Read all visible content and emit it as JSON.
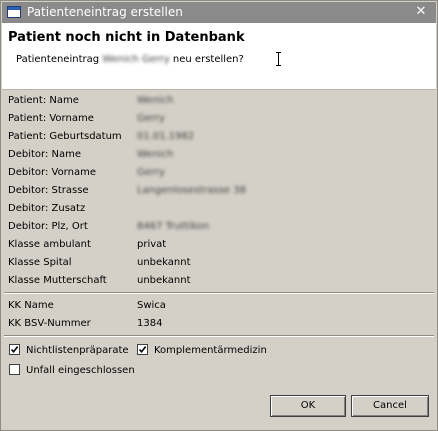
{
  "window": {
    "title": "Patienteneintrag erstellen",
    "close_glyph": "✕"
  },
  "header": {
    "title": "Patient noch nicht in Datenbank",
    "msg_prefix": "Patienteneintrag",
    "msg_name": "Wenich Gerry",
    "msg_suffix": "neu erstellen?"
  },
  "patient_fields": [
    {
      "label": "Patient: Name",
      "value": "Wenich",
      "blurred": true
    },
    {
      "label": "Patient: Vorname",
      "value": "Gerry",
      "blurred": true
    },
    {
      "label": "Patient: Geburtsdatum",
      "value": "01.01.1982",
      "blurred": true
    },
    {
      "label": "Debitor: Name",
      "value": "Wenich",
      "blurred": true
    },
    {
      "label": "Debitor: Vorname",
      "value": "Gerry",
      "blurred": true
    },
    {
      "label": "Debitor: Strasse",
      "value": "Langenlosestrasse 38",
      "blurred": true
    },
    {
      "label": "Debitor: Zusatz",
      "value": "",
      "blurred": false
    },
    {
      "label": "Debitor: Plz, Ort",
      "value": "8467 Truttikon",
      "blurred": true
    },
    {
      "label": "Klasse ambulant",
      "value": "privat",
      "blurred": false
    },
    {
      "label": "Klasse Spital",
      "value": "unbekannt",
      "blurred": false
    },
    {
      "label": "Klasse Mutterschaft",
      "value": "unbekannt",
      "blurred": false
    }
  ],
  "kk_fields": [
    {
      "label": "KK Name",
      "value": "Swica"
    },
    {
      "label": "KK BSV-Nummer",
      "value": "1384"
    }
  ],
  "checkboxes": {
    "nichtlisten": {
      "label": "Nichtlistenpräparate",
      "checked": true
    },
    "komplementaer": {
      "label": "Komplementärmedizin",
      "checked": true
    },
    "unfall": {
      "label": "Unfall eingeschlossen",
      "checked": false
    }
  },
  "buttons": {
    "ok": "OK",
    "cancel": "Cancel"
  },
  "icons": {
    "window": "window-icon",
    "close": "close-icon",
    "check": "checkmark-icon",
    "cursor": "text-cursor-icon"
  }
}
